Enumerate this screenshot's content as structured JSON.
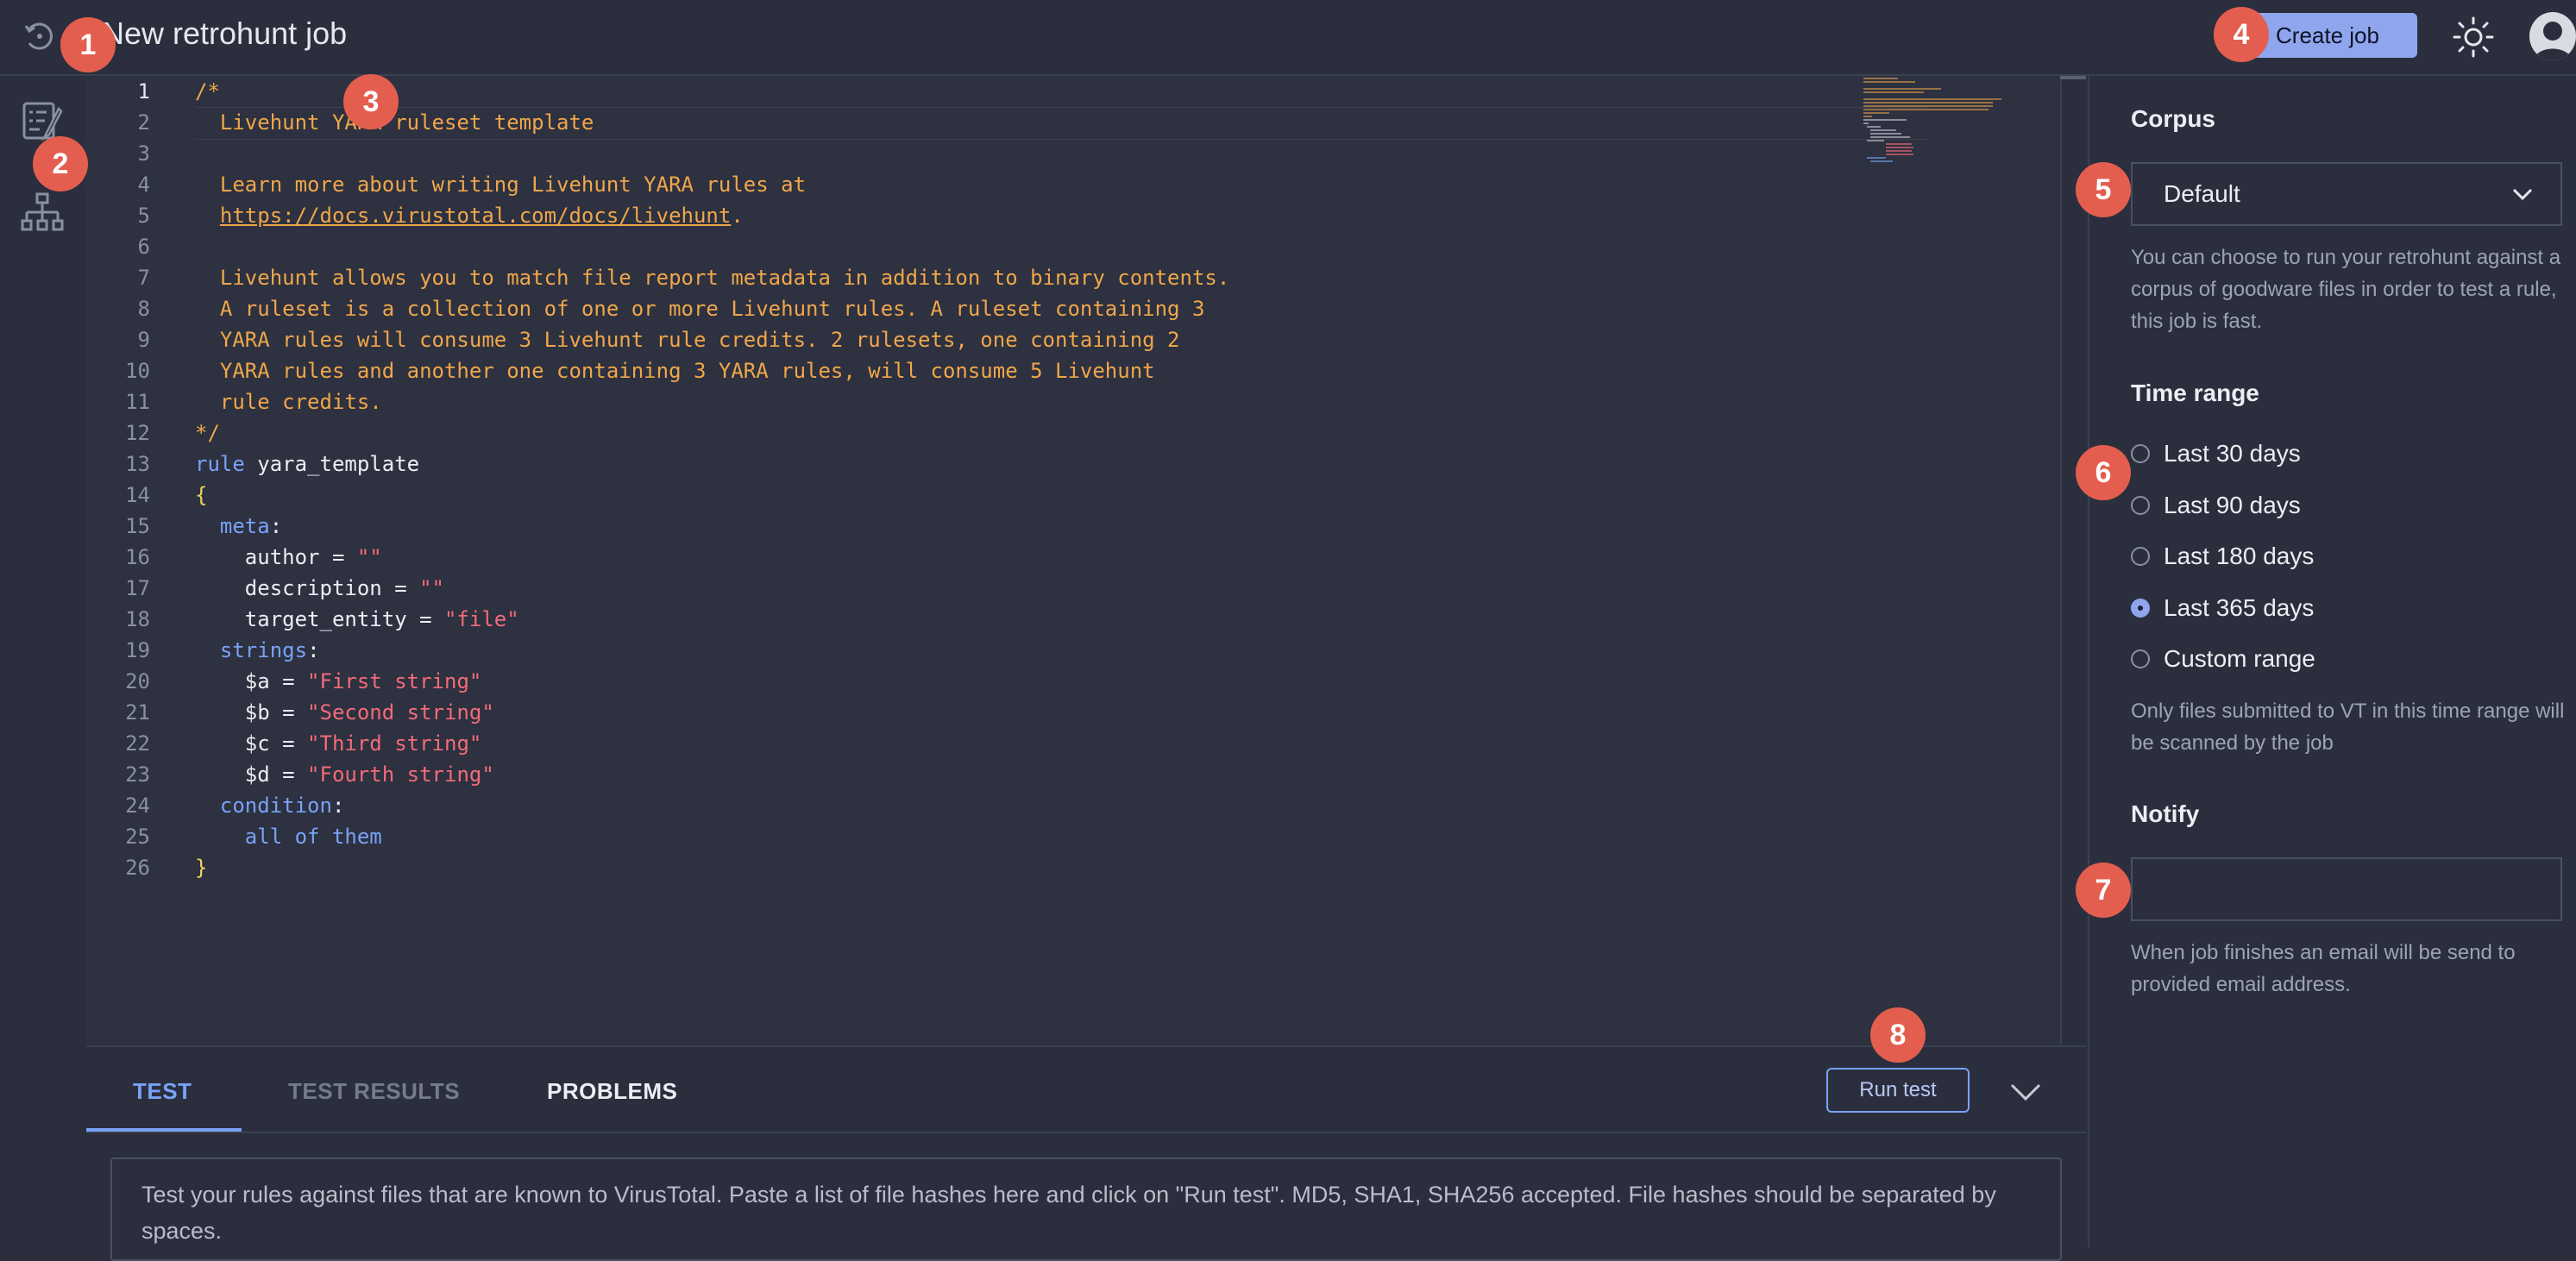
{
  "header": {
    "title": "New retrohunt job",
    "create_label": "Create job"
  },
  "nav": {
    "items": [
      "rules-editor-icon",
      "hierarchy-icon"
    ]
  },
  "editor": {
    "line_numbers": [
      "1",
      "2",
      "3",
      "4",
      "5",
      "6",
      "7",
      "8",
      "9",
      "10",
      "11",
      "12",
      "13",
      "14",
      "15",
      "16",
      "17",
      "18",
      "19",
      "20",
      "21",
      "22",
      "23",
      "24",
      "25",
      "26"
    ],
    "lines": [
      [
        {
          "t": "/*",
          "c": "comment"
        }
      ],
      [
        {
          "t": "  Livehunt YARA ruleset template",
          "c": "comment"
        }
      ],
      [
        {
          "t": "",
          "c": "comment"
        }
      ],
      [
        {
          "t": "  Learn more about writing Livehunt YARA rules at",
          "c": "comment"
        }
      ],
      [
        {
          "t": "  ",
          "c": "comment"
        },
        {
          "t": "https://docs.virustotal.com/docs/livehunt",
          "c": "link"
        },
        {
          "t": ".",
          "c": "comment"
        }
      ],
      [
        {
          "t": "",
          "c": "comment"
        }
      ],
      [
        {
          "t": "  Livehunt allows you to match file report metadata in addition to binary contents.",
          "c": "comment"
        }
      ],
      [
        {
          "t": "  A ruleset is a collection of one or more Livehunt rules. A ruleset containing 3",
          "c": "comment"
        }
      ],
      [
        {
          "t": "  YARA rules will consume 3 Livehunt rule credits. 2 rulesets, one containing 2",
          "c": "comment"
        }
      ],
      [
        {
          "t": "  YARA rules and another one containing 3 YARA rules, will consume 5 Livehunt",
          "c": "comment"
        }
      ],
      [
        {
          "t": "  rule credits.",
          "c": "comment"
        }
      ],
      [
        {
          "t": "*/",
          "c": "comment"
        }
      ],
      [
        {
          "t": "rule",
          "c": "kw"
        },
        {
          "t": " yara_template",
          "c": "plain"
        }
      ],
      [
        {
          "t": "{",
          "c": "brace"
        }
      ],
      [
        {
          "t": "  ",
          "c": "plain"
        },
        {
          "t": "meta",
          "c": "kw"
        },
        {
          "t": ":",
          "c": "plain"
        }
      ],
      [
        {
          "t": "    author = ",
          "c": "plain"
        },
        {
          "t": "\"\"",
          "c": "str"
        }
      ],
      [
        {
          "t": "    description = ",
          "c": "plain"
        },
        {
          "t": "\"\"",
          "c": "str"
        }
      ],
      [
        {
          "t": "    target_entity = ",
          "c": "plain"
        },
        {
          "t": "\"file\"",
          "c": "str"
        }
      ],
      [
        {
          "t": "  ",
          "c": "plain"
        },
        {
          "t": "strings",
          "c": "kw"
        },
        {
          "t": ":",
          "c": "plain"
        }
      ],
      [
        {
          "t": "    $a = ",
          "c": "plain"
        },
        {
          "t": "\"First string\"",
          "c": "str"
        }
      ],
      [
        {
          "t": "    $b = ",
          "c": "plain"
        },
        {
          "t": "\"Second string\"",
          "c": "str"
        }
      ],
      [
        {
          "t": "    $c = ",
          "c": "plain"
        },
        {
          "t": "\"Third string\"",
          "c": "str"
        }
      ],
      [
        {
          "t": "    $d = ",
          "c": "plain"
        },
        {
          "t": "\"Fourth string\"",
          "c": "str"
        }
      ],
      [
        {
          "t": "  ",
          "c": "plain"
        },
        {
          "t": "condition",
          "c": "kw"
        },
        {
          "t": ":",
          "c": "plain"
        }
      ],
      [
        {
          "t": "    all of them",
          "c": "kw"
        }
      ],
      [
        {
          "t": "}",
          "c": "brace"
        }
      ]
    ]
  },
  "bottom": {
    "tabs": [
      {
        "label": "TEST",
        "state": "active"
      },
      {
        "label": "TEST RESULTS",
        "state": "disabled"
      },
      {
        "label": "PROBLEMS",
        "state": "normal"
      }
    ],
    "run_label": "Run test",
    "hash_text": "Test your rules against files that are known to VirusTotal. Paste a list of file hashes here and click on \"Run test\". MD5, SHA1, SHA256 accepted. File hashes should be separated by spaces."
  },
  "panel": {
    "corpus_title": "Corpus",
    "corpus_value": "Default",
    "corpus_help": "You can choose to run your retrohunt against a corpus of goodware files in order to test a rule, this job is fast.",
    "time_title": "Time range",
    "time_options": [
      {
        "label": "Last 30 days",
        "checked": false
      },
      {
        "label": "Last 90 days",
        "checked": false
      },
      {
        "label": "Last 180 days",
        "checked": false
      },
      {
        "label": "Last 365 days",
        "checked": true
      },
      {
        "label": "Custom range",
        "checked": false
      }
    ],
    "time_help": "Only files submitted to VT in this time range will be scanned by the job",
    "notify_title": "Notify",
    "notify_value": "",
    "notify_help": "When job finishes an email will be send to provided email address."
  },
  "markers": [
    "1",
    "2",
    "3",
    "4",
    "5",
    "6",
    "7",
    "8"
  ],
  "colors": {
    "background": "#2b2f3d",
    "accent": "#8fa6ee",
    "comment": "#f0a64a",
    "keyword": "#7aa2f7",
    "string": "#f36b78",
    "marker": "#e45e4f"
  }
}
